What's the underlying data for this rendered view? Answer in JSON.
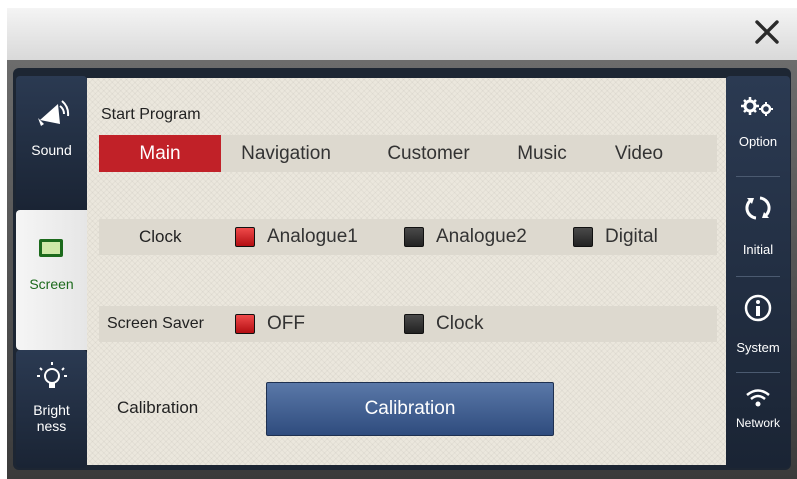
{
  "left_nav": [
    {
      "label": "Sound",
      "icon": "speaker-icon"
    },
    {
      "label": "Screen",
      "icon": "monitor-icon"
    },
    {
      "label_line1": "Bright",
      "label_line2": "ness",
      "icon": "bulb-icon"
    }
  ],
  "right_nav": [
    {
      "label": "Option",
      "icon": "gears-icon"
    },
    {
      "label": "Initial",
      "icon": "refresh-icon"
    },
    {
      "label": "System",
      "icon": "info-icon"
    },
    {
      "label": "Network",
      "icon": "wifi-icon"
    }
  ],
  "start_program": {
    "label": "Start Program",
    "tabs": [
      "Main",
      "Navigation",
      "Customer",
      "Music",
      "Video"
    ],
    "selected": "Main"
  },
  "clock": {
    "label": "Clock",
    "options": [
      {
        "label": "Analogue1",
        "checked": true
      },
      {
        "label": "Analogue2",
        "checked": false
      },
      {
        "label": "Digital",
        "checked": false
      }
    ]
  },
  "screen_saver": {
    "label": "Screen Saver",
    "options": [
      {
        "label": "OFF",
        "checked": true
      },
      {
        "label": "Clock",
        "checked": false
      }
    ]
  },
  "calibration": {
    "label": "Calibration",
    "button_label": "Calibration"
  },
  "colors": {
    "accent": "#c12128",
    "nav_bg": "#1f2b3d",
    "button_blue": "#3f5f93"
  }
}
